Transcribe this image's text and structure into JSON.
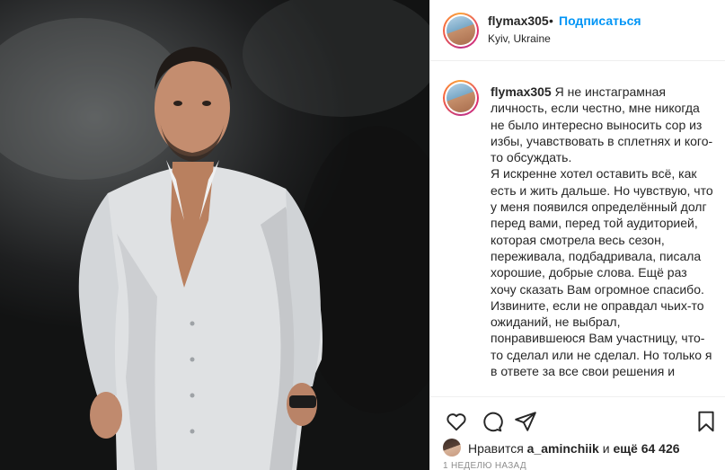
{
  "post": {
    "username": "flymax305",
    "separator": "•",
    "follow_label": "Подписаться",
    "location": "Kyiv, Ukraine"
  },
  "caption": {
    "username": "flymax305",
    "paragraphs": [
      "Я не инстаграмная личность, если честно, мне никогда не было интересно выносить сор из избы, учавствовать в сплетнях и кого-то обсуждать.",
      "Я искренне хотел оставить всё, как есть и жить дальше. Но чувствую, что у меня появился определённый долг перед вами, перед той аудиторией, которая смотрела весь сезон, переживала, подбадривала, писала хорошие, добрые слова. Ещё раз хочу сказать Вам огромное спасибо.",
      "Извините, если не оправдал чьих-то ожиданий, не выбрал, понравившеюся Вам участницу, что-то сделал или не сделал. Но только я в ответе за все свои решения и"
    ]
  },
  "actions": {
    "like_icon": "heart-icon",
    "comment_icon": "comment-icon",
    "share_icon": "share-icon",
    "save_icon": "bookmark-icon"
  },
  "likes": {
    "prefix": "Нравится",
    "user": "a_aminchiik",
    "middle": "и",
    "others": "ещё 64 426"
  },
  "timestamp": "1 НЕДЕЛЮ НАЗАД"
}
